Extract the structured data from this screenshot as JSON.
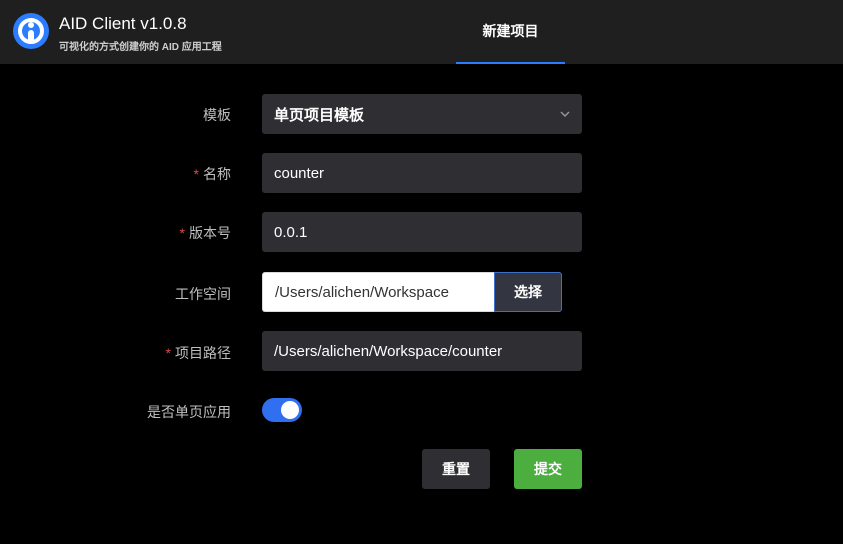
{
  "header": {
    "title": "AID Client v1.0.8",
    "subtitle": "可视化的方式创建你的 AID 应用工程",
    "tab_label": "新建项目",
    "accent_color": "#2b7cff"
  },
  "form": {
    "template": {
      "label": "模板",
      "value": "单页项目模板",
      "icon": "chevron-down-icon"
    },
    "name": {
      "label": "名称",
      "required": true,
      "value": "counter"
    },
    "version": {
      "label": "版本号",
      "required": true,
      "value": "0.0.1"
    },
    "workspace": {
      "label": "工作空间",
      "value": "/Users/alichen/Workspace",
      "button_label": "选择"
    },
    "project_path": {
      "label": "项目路径",
      "required": true,
      "value": "/Users/alichen/Workspace/counter"
    },
    "single_page": {
      "label": "是否单页应用",
      "enabled": true
    },
    "required_mark": "*"
  },
  "actions": {
    "reset_label": "重置",
    "submit_label": "提交",
    "submit_color": "#4cae3f"
  }
}
